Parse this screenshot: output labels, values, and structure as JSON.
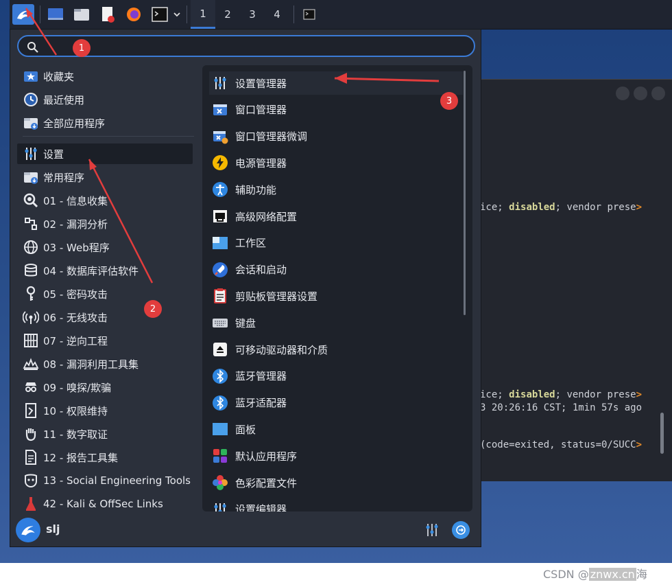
{
  "taskbar": {
    "workspaces": [
      "1",
      "2",
      "3",
      "4"
    ],
    "active_workspace": "1",
    "icons": [
      "kali-dragon-icon",
      "desktop-icon",
      "file-manager-icon",
      "text-editor-icon",
      "firefox-icon",
      "terminal-icon",
      "chevron-down-icon",
      "terminal-window-icon"
    ]
  },
  "terminal": {
    "lines": [
      {
        "pre": "ice; ",
        "bold": "disabled",
        "post": "; vendor prese",
        "arrow": ">"
      },
      {
        "pre": "ice; ",
        "bold": "disabled",
        "post": "; vendor prese",
        "arrow": ">"
      },
      {
        "pre": "3 20:26:16 CST; 1min 57s ago",
        "bold": "",
        "post": "",
        "arrow": ""
      },
      {
        "pre": "(code=exited, status=0/SUCC",
        "bold": "",
        "post": "",
        "arrow": ">"
      }
    ]
  },
  "search": {
    "value": "",
    "placeholder": ""
  },
  "categories": [
    {
      "label": "收藏夹",
      "icon": "star-folder-icon"
    },
    {
      "label": "最近使用",
      "icon": "clock-icon"
    },
    {
      "label": "全部应用程序",
      "icon": "folder-download-icon"
    },
    {
      "label": "设置",
      "icon": "settings-sliders-icon"
    },
    {
      "label": "常用程序",
      "icon": "folder-download-icon"
    },
    {
      "label": "01 - 信息收集",
      "icon": "magnifier-icon"
    },
    {
      "label": "02 - 漏洞分析",
      "icon": "bug-scan-icon"
    },
    {
      "label": "03 - Web程序",
      "icon": "globe-icon"
    },
    {
      "label": "04 - 数据库评估软件",
      "icon": "database-icon"
    },
    {
      "label": "05 - 密码攻击",
      "icon": "key-icon"
    },
    {
      "label": "06 - 无线攻击",
      "icon": "wireless-icon"
    },
    {
      "label": "07 - 逆向工程",
      "icon": "chip-icon"
    },
    {
      "label": "08 - 漏洞利用工具集",
      "icon": "explosion-icon"
    },
    {
      "label": "09 - 嗅探/欺骗",
      "icon": "spy-icon"
    },
    {
      "label": "10 - 权限维持",
      "icon": "door-icon"
    },
    {
      "label": "11 - 数字取证",
      "icon": "hand-icon"
    },
    {
      "label": "12 - 报告工具集",
      "icon": "document-icon"
    },
    {
      "label": "13 - Social Engineering Tools",
      "icon": "mask-icon"
    },
    {
      "label": "42 - Kali & OffSec Links",
      "icon": "kali-red-icon"
    }
  ],
  "active_category": "设置",
  "apps": [
    {
      "label": "设置管理器",
      "icon": "settings-sliders-icon"
    },
    {
      "label": "窗口管理器",
      "icon": "window-x-icon"
    },
    {
      "label": "窗口管理器微调",
      "icon": "window-tweaks-icon"
    },
    {
      "label": "电源管理器",
      "icon": "lightning-icon"
    },
    {
      "label": "辅助功能",
      "icon": "accessibility-icon"
    },
    {
      "label": "高级网络配置",
      "icon": "network-port-icon"
    },
    {
      "label": "工作区",
      "icon": "workspace-icon"
    },
    {
      "label": "会话和启动",
      "icon": "rocket-icon"
    },
    {
      "label": "剪贴板管理器设置",
      "icon": "clipboard-icon"
    },
    {
      "label": "键盘",
      "icon": "keyboard-icon"
    },
    {
      "label": "可移动驱动器和介质",
      "icon": "eject-icon"
    },
    {
      "label": "蓝牙管理器",
      "icon": "bluetooth-icon"
    },
    {
      "label": "蓝牙适配器",
      "icon": "bluetooth-icon"
    },
    {
      "label": "面板",
      "icon": "panel-icon"
    },
    {
      "label": "默认应用程序",
      "icon": "default-apps-icon"
    },
    {
      "label": "色彩配置文件",
      "icon": "color-profile-icon"
    },
    {
      "label": "设置编辑器",
      "icon": "settings-sliders-icon"
    }
  ],
  "user": {
    "name": "slj"
  },
  "markers": [
    "1",
    "2",
    "3"
  ],
  "watermark": {
    "part1": "CSDN @",
    "part2": "znwx.cn",
    "part3": "海"
  },
  "colors": {
    "accent": "#3b7bd6",
    "marker": "#e23d3d",
    "menu_bg": "#2b303b"
  }
}
